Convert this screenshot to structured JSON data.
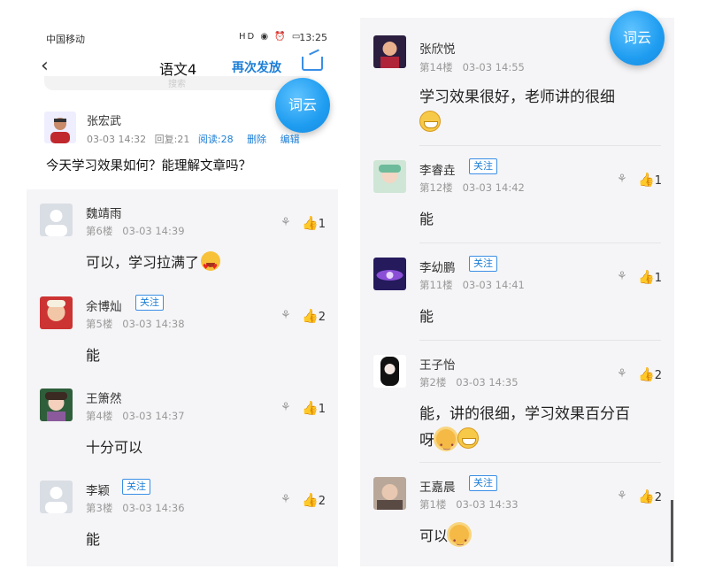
{
  "left": {
    "status": {
      "carrier": "中国移动",
      "icons": "HD ◉ ⏰ ▭",
      "time": "13:25"
    },
    "nav": {
      "title": "语文4",
      "resend": "再次发放"
    },
    "search_peek": "搜索",
    "fab": "词云",
    "post": {
      "author": "张宏武",
      "date": "03-03 14:32",
      "replies": "回复:21",
      "reads": "阅读:28",
      "delete": "删除",
      "edit": "编辑",
      "question": "今天学习效果如何？能理解文章吗？"
    },
    "comments": [
      {
        "name": "魏靖雨",
        "follow": "",
        "floor": "第6楼",
        "time": "03-03 14:39",
        "text": "可以，学习拉满了",
        "likes": "1"
      },
      {
        "name": "余博灿",
        "follow": "关注",
        "floor": "第5楼",
        "time": "03-03 14:38",
        "text": "能",
        "likes": "2"
      },
      {
        "name": "王箫然",
        "follow": "",
        "floor": "第4楼",
        "time": "03-03 14:37",
        "text": "十分可以",
        "likes": "1"
      },
      {
        "name": "李颖",
        "follow": "关注",
        "floor": "第3楼",
        "time": "03-03 14:36",
        "text": "能",
        "likes": "2"
      }
    ]
  },
  "right": {
    "fab": "词云",
    "comments": [
      {
        "name": "张欣悦",
        "follow": "",
        "floor": "第14楼",
        "time": "03-03 14:55",
        "text": "学习效果很好，老师讲的很细",
        "likes": ""
      },
      {
        "name": "李睿垚",
        "follow": "关注",
        "floor": "第12楼",
        "time": "03-03 14:42",
        "text": "能",
        "likes": "1"
      },
      {
        "name": "李幼鹏",
        "follow": "关注",
        "floor": "第11楼",
        "time": "03-03 14:41",
        "text": "能",
        "likes": "1"
      },
      {
        "name": "王子怡",
        "follow": "",
        "floor": "第2楼",
        "time": "03-03 14:35",
        "text": "能，讲的很细，学习效果百分百",
        "text2": "呀",
        "likes": "2"
      },
      {
        "name": "王嘉晨",
        "follow": "关注",
        "floor": "第1楼",
        "time": "03-03 14:33",
        "text": "可以",
        "likes": "2"
      }
    ]
  },
  "colors": {
    "accent": "#1c7ed6",
    "fab": "#1e9cf0",
    "list_bg": "#f5f5f7"
  }
}
